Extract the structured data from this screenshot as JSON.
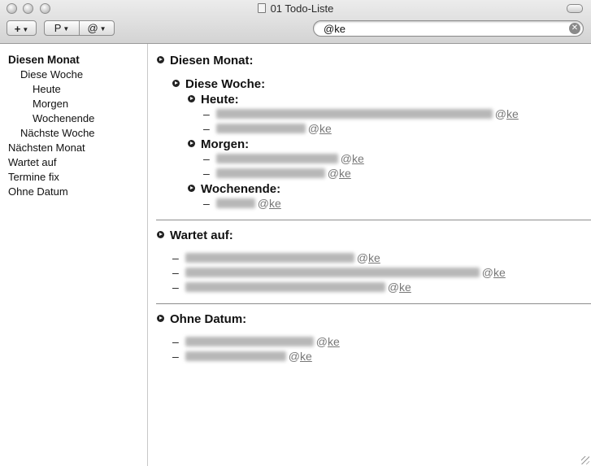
{
  "window": {
    "title": "01 Todo-Liste"
  },
  "toolbar": {
    "add_label": "+",
    "project_label": "P",
    "context_label": "@"
  },
  "search": {
    "value": "@ke"
  },
  "sidebar": {
    "items": [
      {
        "label": "Diesen Monat",
        "level": 0,
        "bold": true
      },
      {
        "label": "Diese Woche",
        "level": 1
      },
      {
        "label": "Heute",
        "level": 2
      },
      {
        "label": "Morgen",
        "level": 2
      },
      {
        "label": "Wochenende",
        "level": 2
      },
      {
        "label": "Nächste Woche",
        "level": 1
      },
      {
        "label": "Nächsten Monat",
        "level": 0
      },
      {
        "label": "Wartet auf",
        "level": 0
      },
      {
        "label": "Termine fix",
        "level": 0
      },
      {
        "label": "Ohne Datum",
        "level": 0
      }
    ]
  },
  "main": {
    "sections": [
      {
        "title": "Diesen Monat:"
      },
      {
        "title": "Diese Woche:"
      },
      {
        "title": "Heute:"
      },
      {
        "title": "Morgen:"
      },
      {
        "title": "Wochenende:"
      },
      {
        "title": "Wartet auf:"
      },
      {
        "title": "Ohne Datum:"
      }
    ],
    "tasks": [
      {
        "dash": "–",
        "tag_prefix": "@",
        "tag_name": "ke"
      },
      {
        "dash": "–",
        "tag_prefix": "@",
        "tag_name": "ke"
      },
      {
        "dash": "–",
        "tag_prefix": "@",
        "tag_name": "ke"
      },
      {
        "dash": "–",
        "tag_prefix": "@",
        "tag_name": "ke"
      },
      {
        "dash": "–",
        "tag_prefix": "@",
        "tag_name": "ke"
      },
      {
        "dash": "–",
        "tag_prefix": "@",
        "tag_name": "ke"
      },
      {
        "dash": "–",
        "tag_prefix": "@",
        "tag_name": "ke"
      },
      {
        "dash": "–",
        "tag_prefix": "@",
        "tag_name": "ke"
      },
      {
        "dash": "–",
        "tag_prefix": "@",
        "tag_name": "ke"
      },
      {
        "dash": "–",
        "tag_prefix": "@",
        "tag_name": "ke"
      }
    ]
  },
  "icons": {
    "toggle": "disclosure-toggle-icon",
    "clear": "clear-search-icon",
    "document": "document-icon"
  }
}
